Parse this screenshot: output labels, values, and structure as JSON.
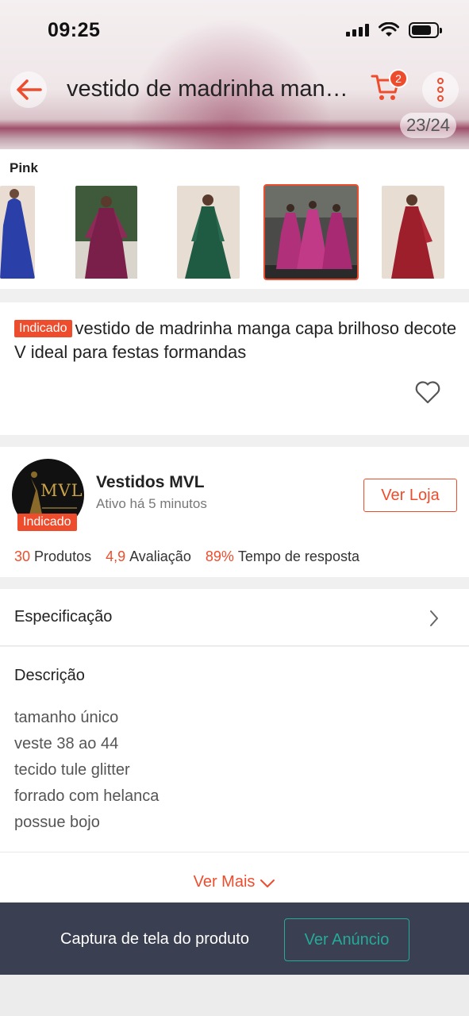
{
  "status_bar": {
    "time": "09:25"
  },
  "nav": {
    "title": "vestido de madrinha manga capa brilhoso decote V ideal para festas formandas",
    "cart_count": "2"
  },
  "gallery": {
    "counter": "23/24"
  },
  "variant": {
    "label": "Pink",
    "thumbnails": [
      {
        "name": "blue",
        "color": "#2a3fa8",
        "selected": false
      },
      {
        "name": "wine",
        "color": "#7a1f4a",
        "selected": false
      },
      {
        "name": "green",
        "color": "#1f5a42",
        "selected": false
      },
      {
        "name": "pink",
        "color": "#b0307a",
        "selected": true
      },
      {
        "name": "red",
        "color": "#9e1f2c",
        "selected": false
      }
    ]
  },
  "product": {
    "tag": "Indicado",
    "title": "vestido de madrinha manga capa brilhoso decote V ideal para festas formandas"
  },
  "shop": {
    "logo_text": "MVL",
    "tag": "Indicado",
    "name": "Vestidos MVL",
    "status": "Ativo há 5 minutos",
    "button": "Ver Loja",
    "stats": [
      {
        "value": "30",
        "label": "Produtos"
      },
      {
        "value": "4,9",
        "label": "Avaliação"
      },
      {
        "value": "89%",
        "label": "Tempo de resposta"
      }
    ]
  },
  "specification": {
    "label": "Especificação"
  },
  "description": {
    "title": "Descrição",
    "lines": [
      "tamanho único",
      "veste 38 ao 44",
      "tecido tule glitter",
      "forrado com helanca",
      "possue bojo"
    ],
    "see_more": "Ver Mais"
  },
  "banner": {
    "text": "Captura de tela do produto",
    "button": "Ver Anúncio"
  },
  "colors": {
    "accent": "#ee4d2d",
    "teal": "#26aa99",
    "banner_bg": "#3b3f52"
  }
}
